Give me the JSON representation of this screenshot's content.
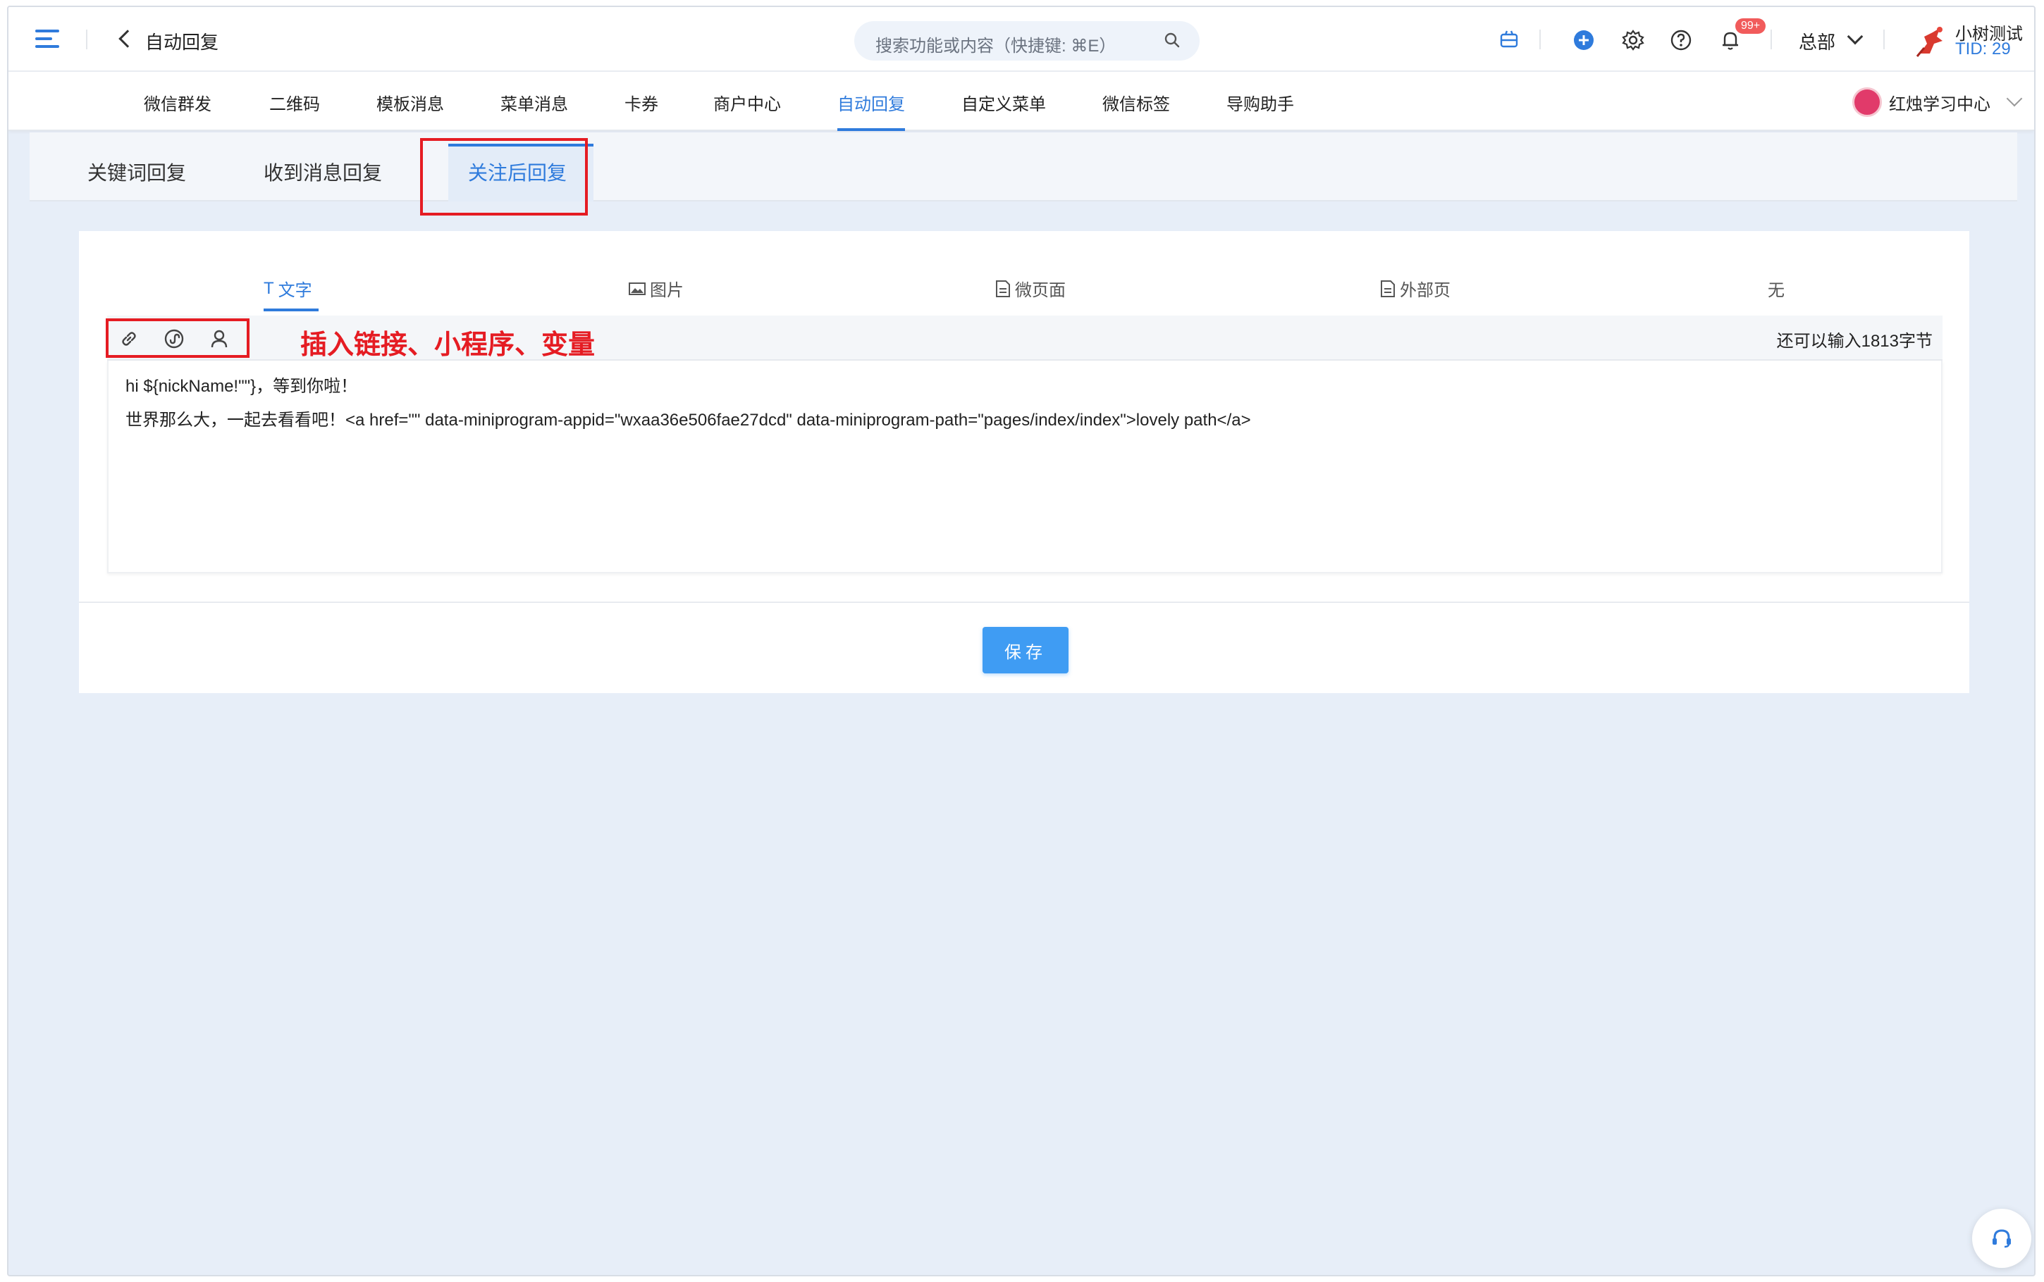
{
  "header": {
    "title": "自动回复",
    "search_placeholder": "搜索功能或内容（快捷键: ⌘E）",
    "badge": "99+",
    "org": "总部",
    "user": "小树测试",
    "tid": "TID: 29"
  },
  "nav": {
    "items": [
      "微信群发",
      "二维码",
      "模板消息",
      "菜单消息",
      "卡券",
      "商户中心",
      "自动回复",
      "自定义菜单",
      "微信标签",
      "导购助手"
    ],
    "active": "自动回复",
    "shop": "红烛学习中心"
  },
  "subtabs": {
    "items": [
      "关键词回复",
      "收到消息回复",
      "关注后回复"
    ],
    "active": "关注后回复"
  },
  "content_tabs": {
    "items": [
      "文字",
      "图片",
      "微页面",
      "外部页",
      "无"
    ],
    "active": "文字"
  },
  "editor": {
    "hint": "插入链接、小程序、变量",
    "counter": "还可以输入1813字节",
    "lines": [
      "hi ${nickName!\"\"}，等到你啦！",
      "世界那么大，一起去看看吧！<a href=\"\" data-miniprogram-appid=\"wxaa36e506fae27dcd\" data-miniprogram-path=\"pages/index/index\">lovely path</a>"
    ]
  },
  "actions": {
    "save": "保存"
  },
  "colors": {
    "accent": "#2f7bdc",
    "highlight": "#e51c23",
    "button": "#3f9cf3"
  }
}
